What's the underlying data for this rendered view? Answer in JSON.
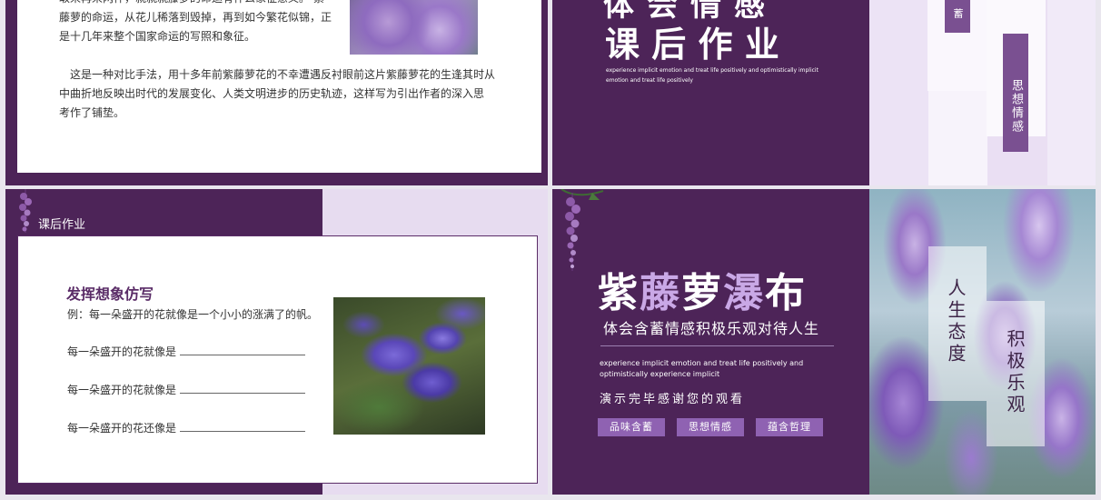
{
  "s1": {
    "para1_top": "取来再来两件，就就就藤萝的命运有什么象征意义。 紫",
    "para1_lines": [
      "藤萝的命运，从花儿稀落到毁掉，再到如今繁花似锦，正",
      "是十几年来整个国家命运的写照和象征。"
    ],
    "para2_lines": [
      "这是一种对比手法，用十多年前紫藤萝花的不幸遭遇反衬眼前这片紫藤萝花的生逢其时从",
      "中曲折地反映出时代的发展变化、人类文明进步的历史轨迹，这样写为引出作者的深入思",
      "考作了铺垫。"
    ]
  },
  "s2": {
    "partial_title": "体会情感",
    "title": "课 后 作 业",
    "subtitle_lines": [
      "experience implicit emotion and treat life positively and optimistically implicit",
      "emotion and treat life positively"
    ],
    "tag1": "蓄",
    "tag2": "思想情感"
  },
  "s3": {
    "header": "课后作业",
    "heading": "发挥想象仿写",
    "example": "例：每一朵盛开的花就像是一个小小的涨满了的帆。",
    "lines": [
      "每一朵盛开的花就像是",
      "每一朵盛开的花就像是",
      "每一朵盛开的花还像是"
    ]
  },
  "s4": {
    "title_a": "紫",
    "title_b": "藤",
    "title_c": "萝",
    "title_d": "瀑",
    "title_e": "布",
    "subtitle": "体会含蓄情感积极乐观对待人生",
    "english_lines": [
      "experience implicit emotion and treat life positively and",
      "optimistically experience implicit"
    ],
    "thanks": "演示完毕感谢您的观看",
    "tags": [
      "品味含蓄",
      "思想情感",
      "蕴含哲理"
    ],
    "vtext1": "人生态度",
    "vtext2": "积极乐观"
  }
}
